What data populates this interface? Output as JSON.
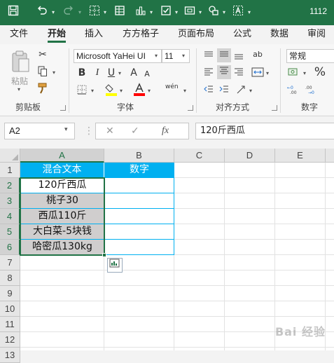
{
  "titlebar": {
    "doc_number": "1112",
    "icons": [
      "save-icon",
      "undo-icon",
      "redo-icon",
      "borders-icon",
      "table-icon",
      "chart-icon",
      "checkbox-icon",
      "screenshot-icon",
      "shapes-icon",
      "textbox-icon"
    ]
  },
  "tabs": [
    "文件",
    "开始",
    "插入",
    "方方格子",
    "页面布局",
    "公式",
    "数据",
    "审阅"
  ],
  "active_tab": "开始",
  "ribbon": {
    "clipboard": {
      "paste_label": "粘贴",
      "group_label": "剪贴板"
    },
    "font": {
      "family": "Microsoft YaHei UI",
      "size": "11",
      "bold": "B",
      "italic": "I",
      "underline": "U",
      "font_grow": "A",
      "font_shrink": "A",
      "phonetic": "wén",
      "group_label": "字体",
      "fill_color": "#ffff00",
      "font_color": "#ff0000"
    },
    "alignment": {
      "group_label": "对齐方式",
      "wrap_text": "ab"
    },
    "number": {
      "format": "常规",
      "percent": "%",
      "group_label": "数字"
    }
  },
  "formula_bar": {
    "name_box": "A2",
    "fx_label": "fx",
    "formula": "120斤西瓜"
  },
  "grid": {
    "columns": [
      "A",
      "B",
      "C",
      "D",
      "E"
    ],
    "rows": [
      "1",
      "2",
      "3",
      "4",
      "5",
      "6",
      "7",
      "8",
      "9",
      "10",
      "11",
      "12",
      "13"
    ],
    "header_row": [
      "混合文本",
      "数字"
    ],
    "data_rows": [
      "120斤西瓜",
      "桃子30",
      "西瓜110斤",
      "大白菜-5块钱",
      "哈密瓜130kg"
    ],
    "header_color": "#00b0f0",
    "selection_color": "#217346"
  },
  "watermark": "Bai 经验"
}
